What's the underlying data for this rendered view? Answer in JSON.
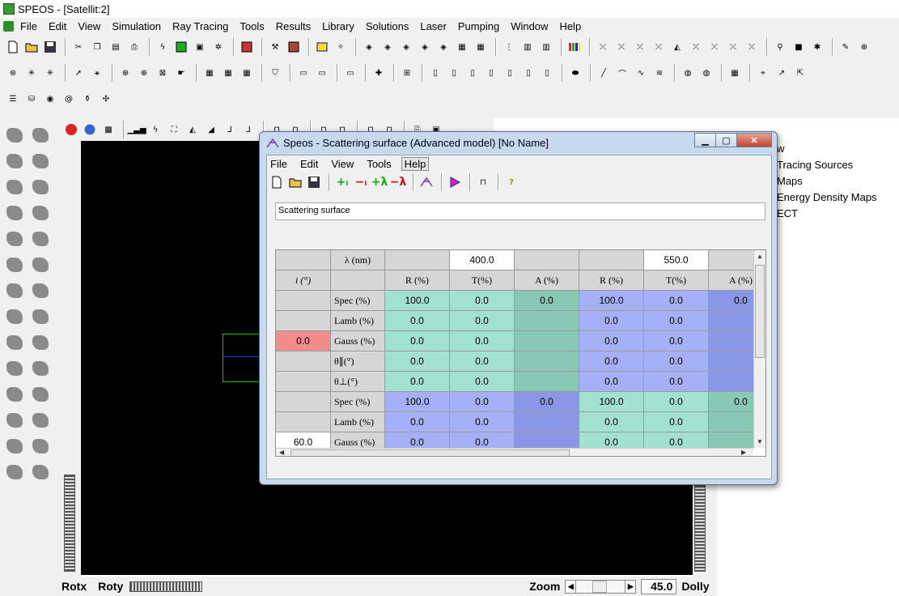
{
  "app": {
    "title": "SPEOS - [Satellit:2]",
    "menu": [
      "File",
      "Edit",
      "View",
      "Simulation",
      "Ray Tracing",
      "Tools",
      "Results",
      "Library",
      "Solutions",
      "Laser",
      "Pumping",
      "Window",
      "Help"
    ]
  },
  "statusbar": {
    "rotx": "Rotx",
    "roty": "Roty",
    "zoom": "Zoom",
    "zoom_value": "45.0",
    "dolly": "Dolly"
  },
  "tree": {
    "items": [
      "w",
      "Tracing Sources",
      "Maps",
      "Energy Density Maps",
      "ECT"
    ]
  },
  "dialog": {
    "title": "Speos - Scattering surface (Advanced model) [No Name]",
    "menu": [
      "File",
      "Edit",
      "View",
      "Tools",
      "Help"
    ],
    "name_value": "Scattering surface",
    "grid": {
      "lambda_label": "λ (nm)",
      "i_label": "i (°)",
      "wavelengths": [
        "400.0",
        "550.0"
      ],
      "col_labels": [
        "R (%)",
        "T(%)",
        "A (%)",
        "R (%)",
        "T(%)",
        "A (%)"
      ],
      "row_labels": [
        "Spec (%)",
        "Lamb (%)",
        "Gauss (%)",
        "θ∥(°)",
        "θ⊥(°)",
        "Spec (%)",
        "Lamb (%)",
        "Gauss (%)"
      ],
      "angles": [
        "0.0",
        "60.0"
      ],
      "rows": [
        [
          "100.0",
          "0.0",
          "0.0",
          "100.0",
          "0.0",
          "0.0"
        ],
        [
          "0.0",
          "0.0",
          "",
          "0.0",
          "0.0",
          ""
        ],
        [
          "0.0",
          "0.0",
          "",
          "0.0",
          "0.0",
          ""
        ],
        [
          "0.0",
          "0.0",
          "",
          "0.0",
          "0.0",
          ""
        ],
        [
          "0.0",
          "0.0",
          "",
          "0.0",
          "0.0",
          ""
        ],
        [
          "100.0",
          "0.0",
          "0.0",
          "100.0",
          "0.0",
          "0.0"
        ],
        [
          "0.0",
          "0.0",
          "",
          "0.0",
          "0.0",
          ""
        ],
        [
          "0.0",
          "0.0",
          "",
          "0.0",
          "0.0",
          ""
        ]
      ]
    }
  },
  "colors": {
    "green_cell": "#a2e0cf",
    "green_dark": "#88c8b4",
    "blue_cell": "#a6b0f6",
    "blue_dark": "#8a96e6",
    "header_gray": "#d6d6d6",
    "angle_highlight": "#f08c8c"
  }
}
